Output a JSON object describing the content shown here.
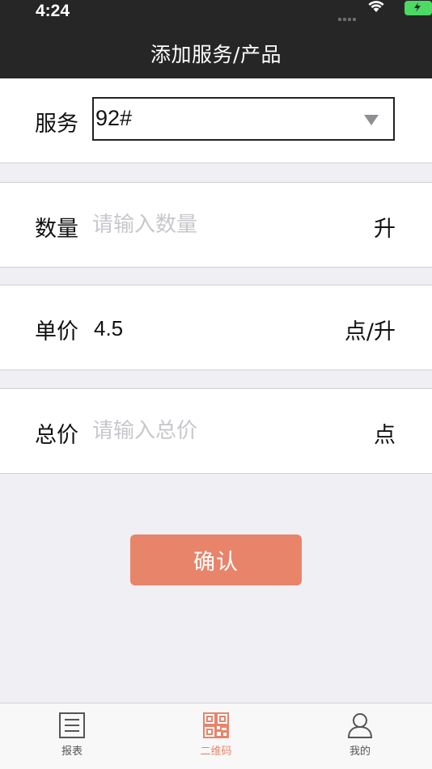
{
  "status_bar": {
    "time": "4:24"
  },
  "header": {
    "title": "添加服务/产品"
  },
  "form": {
    "service": {
      "label": "服务",
      "value": "92#"
    },
    "quantity": {
      "label": "数量",
      "placeholder": "请输入数量",
      "unit": "升"
    },
    "unit_price": {
      "label": "单价",
      "value": "4.5",
      "unit": "点/升"
    },
    "total": {
      "label": "总价",
      "placeholder": "请输入总价",
      "unit": "点"
    }
  },
  "confirm_button": {
    "label": "确认"
  },
  "tabbar": {
    "items": [
      {
        "label": "报表",
        "icon": "list-icon"
      },
      {
        "label": "二维码",
        "icon": "qr-code-icon",
        "active": true
      },
      {
        "label": "我的",
        "icon": "user-icon"
      }
    ]
  },
  "colors": {
    "accent": "#e8846a",
    "header_bg": "#262626",
    "background": "#efeff4"
  }
}
